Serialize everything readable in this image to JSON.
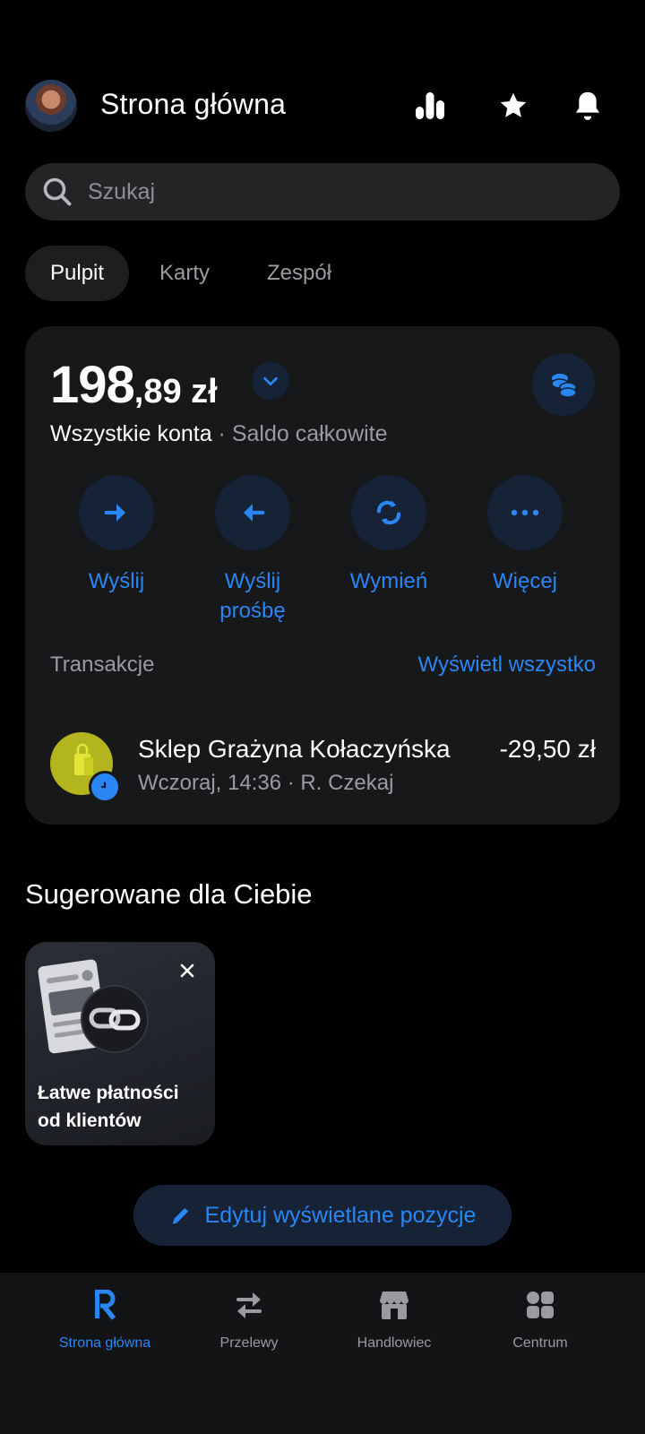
{
  "header": {
    "title": "Strona główna",
    "icons": [
      "stats-icon",
      "star-icon",
      "bell-icon"
    ]
  },
  "search": {
    "placeholder": "Szukaj"
  },
  "tabs": [
    {
      "label": "Pulpit",
      "active": true
    },
    {
      "label": "Karty",
      "active": false
    },
    {
      "label": "Zespół",
      "active": false
    }
  ],
  "balance": {
    "integer": "198",
    "decimal": ",89 zł",
    "accounts": "Wszystkie konta",
    "separator": " · ",
    "total_label": "Saldo całkowite"
  },
  "actions": [
    {
      "label": "Wyślij",
      "icon": "arrow-right-icon"
    },
    {
      "label": "Wyślij prośbę",
      "icon": "arrow-left-icon"
    },
    {
      "label": "Wymień",
      "icon": "exchange-icon"
    },
    {
      "label": "Więcej",
      "icon": "more-icon"
    }
  ],
  "transactions": {
    "heading": "Transakcje",
    "view_all": "Wyświetl wszystko",
    "items": [
      {
        "name": "Sklep Grażyna Kołaczyńska",
        "subtitle": "Wczoraj, 14:36 · R. Czekaj",
        "amount": "-29,50 zł"
      }
    ]
  },
  "suggested": {
    "heading": "Sugerowane dla Ciebie",
    "card_text_line1": "Łatwe płatności",
    "card_text_line2": "od klientów"
  },
  "edit_button": {
    "label": "Edytuj wyświetlane pozycje"
  },
  "bottom_nav": [
    {
      "label": "Strona główna",
      "active": true
    },
    {
      "label": "Przelewy",
      "active": false
    },
    {
      "label": "Handlowiec",
      "active": false
    },
    {
      "label": "Centrum",
      "active": false
    }
  ],
  "colors": {
    "accent": "#2a86f5",
    "card_bg": "#17181a",
    "icon_circle_bg": "#162235",
    "merchant_avatar": "#b2b51d"
  }
}
